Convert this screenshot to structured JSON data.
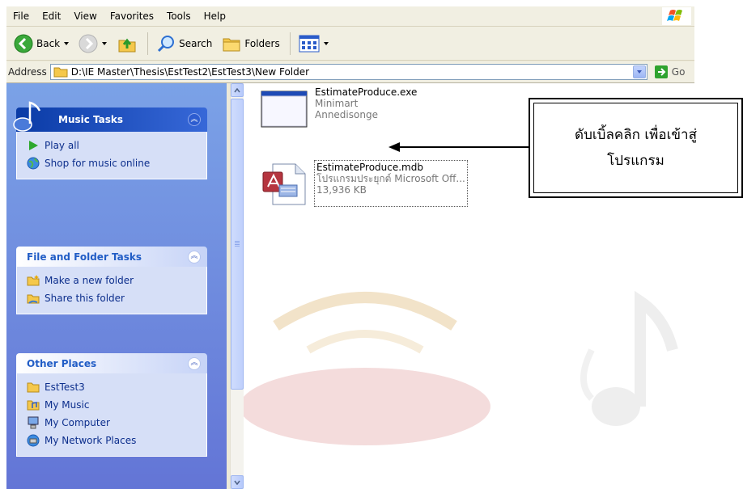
{
  "menu": [
    "File",
    "Edit",
    "View",
    "Favorites",
    "Tools",
    "Help"
  ],
  "toolbar": {
    "back_label": "Back",
    "search_label": "Search",
    "folders_label": "Folders"
  },
  "address": {
    "label": "Address",
    "path": "D:\\IE Master\\Thesis\\EstTest2\\EstTest3\\New Folder",
    "go_label": "Go"
  },
  "panels": {
    "music": {
      "title": "Music Tasks",
      "items": [
        {
          "label": "Play all",
          "icon": "play-icon"
        },
        {
          "label": "Shop for music online",
          "icon": "globe-icon"
        }
      ]
    },
    "file_folder": {
      "title": "File and Folder Tasks",
      "items": [
        {
          "label": "Make a new folder",
          "icon": "new-folder-icon"
        },
        {
          "label": "Share this folder",
          "icon": "share-folder-icon"
        }
      ]
    },
    "other": {
      "title": "Other Places",
      "items": [
        {
          "label": "EstTest3",
          "icon": "folder-icon"
        },
        {
          "label": "My Music",
          "icon": "music-folder-icon"
        },
        {
          "label": "My Computer",
          "icon": "computer-icon"
        },
        {
          "label": "My Network Places",
          "icon": "network-icon"
        }
      ]
    }
  },
  "files": [
    {
      "name": "EstimateProduce.exe",
      "line2": "Minimart",
      "line3": "Annedisonge",
      "icon": "application-window-icon"
    },
    {
      "name": "EstimateProduce.mdb",
      "line2": "โปรแกรมประยุกต์ Microsoft Off...",
      "line3": "13,936 KB",
      "icon": "access-database-icon"
    }
  ],
  "callout": {
    "line1": "ดับเบิ้ลคลิก เพื่อเข้าสู่",
    "line2": "โปรแกรม"
  },
  "colors": {
    "taskpane_gradient_top": "#7ba2e7",
    "taskpane_gradient_bottom": "#6375d6",
    "panel_title": "#215dc6",
    "task_link": "#0c2e8c",
    "music_header": "#0a3ba6"
  }
}
